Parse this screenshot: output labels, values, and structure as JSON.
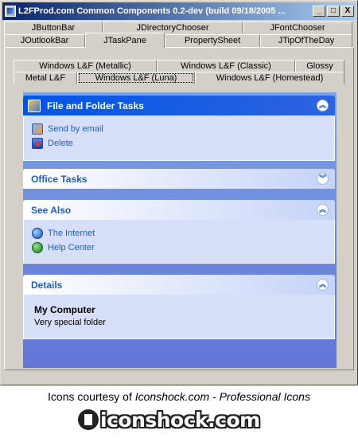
{
  "window": {
    "title": "L2FProd.com Common Components 0.2-dev (build 09/18/2005 ...",
    "minimize_label": "_",
    "maximize_label": "□",
    "close_label": "X"
  },
  "outer_tabs": {
    "row1": [
      "JButtonBar",
      "JDirectoryChooser",
      "JFontChooser"
    ],
    "row2": [
      "JOutlookBar",
      "JTaskPane",
      "PropertySheet",
      "JTipOfTheDay"
    ],
    "selected": "JTaskPane"
  },
  "inner_tabs": {
    "row1": [
      "Windows L&F (Metallic)",
      "Windows L&F (Classic)",
      "Glossy"
    ],
    "row2": [
      "Metal L&F",
      "Windows L&F (Luna)",
      "Windows L&F (Homestead)"
    ],
    "selected": "Windows L&F (Luna)"
  },
  "task_pane": {
    "groups": [
      {
        "title": "File and Folder Tasks",
        "special": true,
        "expanded": true,
        "tasks": [
          {
            "label": "Send by email",
            "icon": "email-icon"
          },
          {
            "label": "Delete",
            "icon": "delete-icon"
          }
        ]
      },
      {
        "title": "Office Tasks",
        "special": false,
        "expanded": false,
        "tasks": []
      },
      {
        "title": "See Also",
        "special": false,
        "expanded": true,
        "tasks": [
          {
            "label": "The Internet",
            "icon": "globe-icon"
          },
          {
            "label": "Help Center",
            "icon": "help-icon"
          }
        ]
      },
      {
        "title": "Details",
        "special": false,
        "expanded": true,
        "details_title": "My Computer",
        "details_sub": "Very special folder"
      }
    ],
    "expanded_glyph": "︽",
    "collapsed_glyph": "︾"
  },
  "footer": {
    "credit_prefix": "Icons courtesy of ",
    "credit_site": "Iconshock.com",
    "credit_suffix": " - Professional Icons",
    "logo_text": "iconshock.com"
  }
}
